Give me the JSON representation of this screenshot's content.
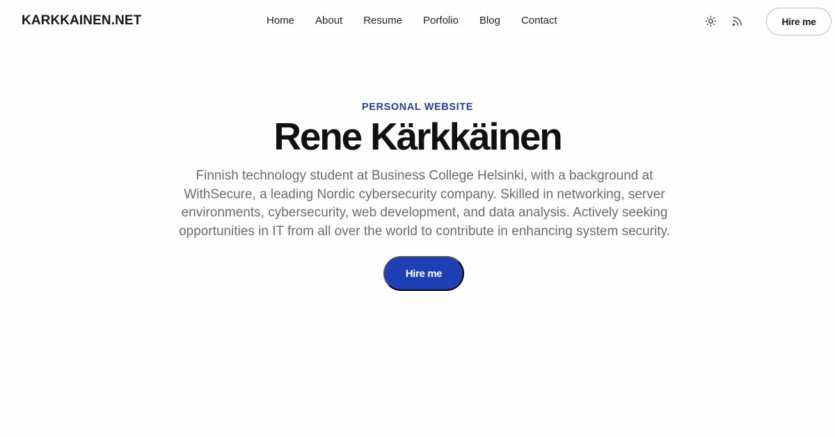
{
  "header": {
    "logo": "KARKKAINEN.NET",
    "nav": [
      "Home",
      "About",
      "Resume",
      "Porfolio",
      "Blog",
      "Contact"
    ],
    "icons": [
      "sun-icon",
      "rss-icon"
    ],
    "hire_label": "Hire me"
  },
  "hero": {
    "eyebrow": "PERSONAL WEBSITE",
    "title": "Rene Kärkkäinen",
    "description": "Finnish technology student at Business College Helsinki, with a background at WithSecure, a leading Nordic cybersecurity company. Skilled in networking, server environments, cybersecurity, web development, and data analysis. Actively seeking opportunities in IT from all over the world to contribute in enhancing system security.",
    "cta_label": "Hire me"
  },
  "colors": {
    "accent": "#1f3fb4",
    "eyebrow": "#24408e",
    "text_muted": "#6b6b6b"
  }
}
